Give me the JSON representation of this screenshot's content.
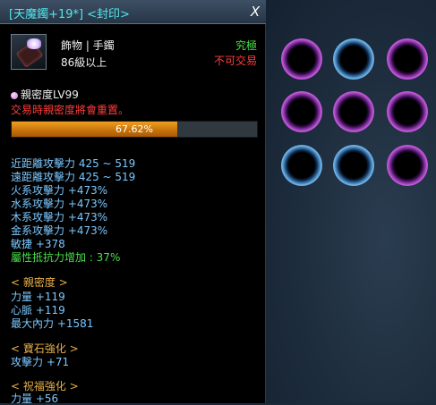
{
  "item": {
    "title": "[天魔鐲+19*]",
    "seal": "<封印>",
    "close_label": "X",
    "icon": "bracelet-icon",
    "type_line": "飾物 | 手鐲",
    "level_line": "86級以上",
    "grade": "究極",
    "trade_status": "不可交易"
  },
  "intimacy": {
    "label": "親密度LV99",
    "warning": "交易時親密度將會重置。",
    "progress_percent": 67.62,
    "progress_text": "67.62%"
  },
  "stats": {
    "melee": "近距離攻擊力 425 ~ 519",
    "ranged": "遠距離攻擊力 425 ~ 519",
    "fire": "火系攻擊力 +473%",
    "water": "水系攻擊力 +473%",
    "wood": "木系攻擊力 +473%",
    "metal": "金系攻擊力 +473%",
    "agility": "敏捷 +378",
    "resist": "屬性抵抗力增加 : 37%"
  },
  "sections": {
    "intimacy_header": "< 親密度 >",
    "intimacy_lines": [
      "力量 +119",
      "心脈 +119",
      "最大內力 +1581"
    ],
    "gem_header": "< 寶石強化 >",
    "gem_lines": [
      "攻擊力 +71"
    ],
    "blessing_header": "< 祝福強化 >",
    "blessing_lines": [
      "力量 +56"
    ]
  },
  "slots": [
    {
      "color": "purple"
    },
    {
      "color": "blue"
    },
    {
      "color": "purple"
    },
    {
      "color": "purple"
    },
    {
      "color": "purple"
    },
    {
      "color": "purple"
    },
    {
      "color": "blue"
    },
    {
      "color": "blue"
    },
    {
      "color": "purple"
    }
  ],
  "colors": {
    "title": "#52e6ea",
    "grade": "#4ae04a",
    "warning": "#ff3c3c",
    "stat": "#7cc8ff",
    "section": "#e8b14a",
    "progress": "#e08a14"
  }
}
